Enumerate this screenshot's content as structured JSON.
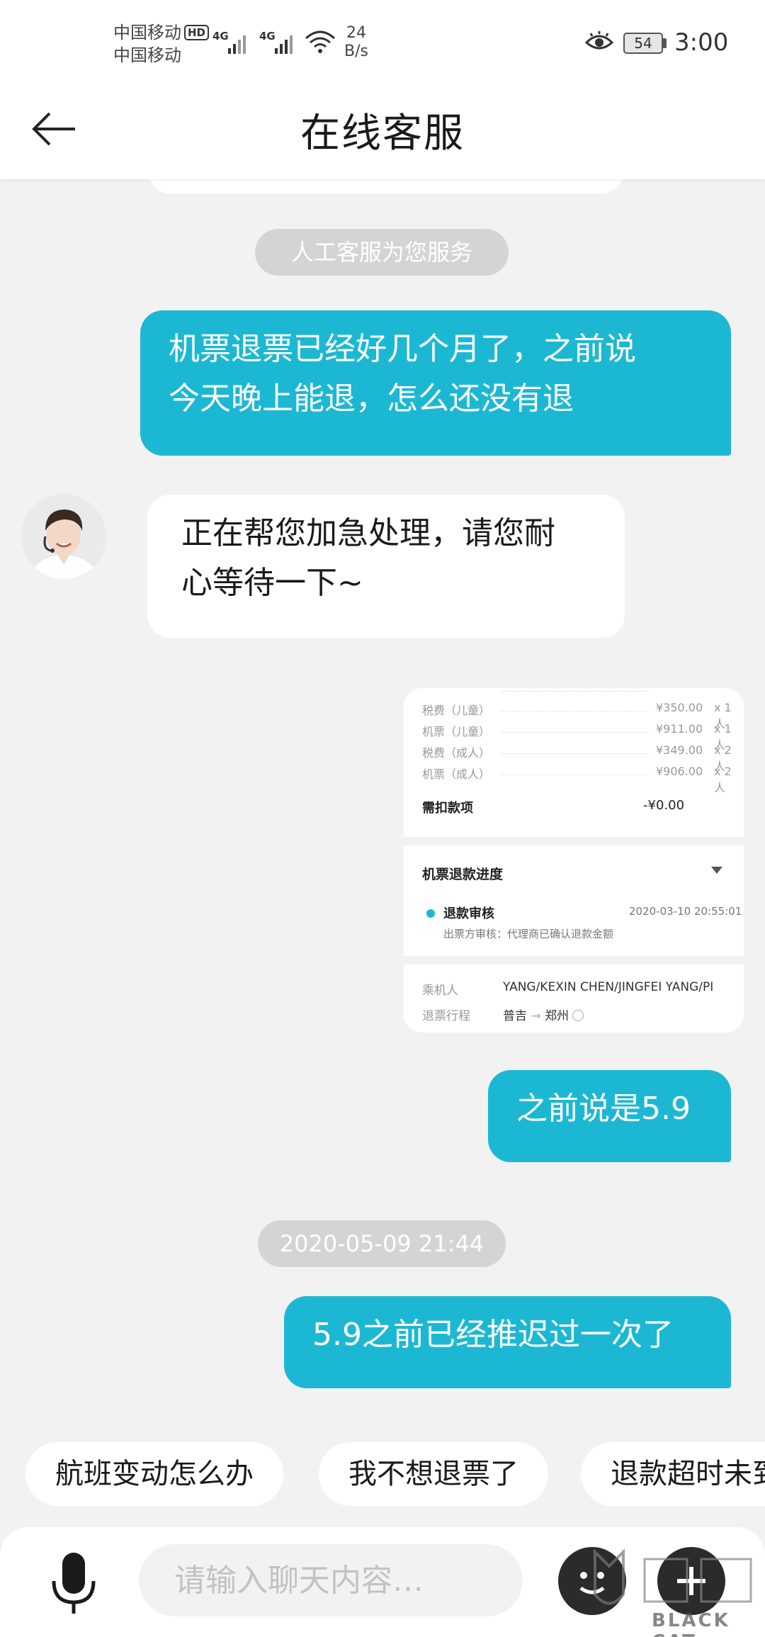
{
  "status_bar": {
    "carrier1": "中国移动",
    "carrier2": "中国移动",
    "hd": "HD",
    "net1": "4G",
    "net2": "4G",
    "speed_value": "24",
    "speed_unit": "B/s",
    "battery": "54",
    "time": "3:00"
  },
  "header": {
    "title": "在线客服"
  },
  "messages": {
    "system_notice": "人工客服为您服务",
    "user_msg_1_line1": "机票退票已经好几个月了，之前说",
    "user_msg_1_line2": "今天晚上能退，怎么还没有退",
    "agent_msg_1_line1": "正在帮您加急处理，请您耐",
    "agent_msg_1_line2": "心等待一下~",
    "user_msg_2": "之前说是5.9",
    "timestamp": "2020-05-09 21:44",
    "user_msg_3": "5.9之前已经推迟过一次了"
  },
  "screenshot_card": {
    "fee_rows": [
      {
        "name": "税费（儿童）",
        "price": "¥350.00",
        "qty": "x 1人"
      },
      {
        "name": "机票（儿童）",
        "price": "¥911.00",
        "qty": "x 1人"
      },
      {
        "name": "税费（成人）",
        "price": "¥349.00",
        "qty": "x 2人"
      },
      {
        "name": "机票（成人）",
        "price": "¥906.00",
        "qty": "x 2人"
      }
    ],
    "deduct_label": "需扣款项",
    "deduct_value": "-¥0.00",
    "progress_title": "机票退款进度",
    "progress_step": "退款审核",
    "progress_time": "2020-03-10 20:55:01",
    "progress_desc": "出票方审核：代理商已确认退款金额",
    "passenger_label": "乘机人",
    "passenger_value": "YANG/KEXIN CHEN/JINGFEI YANG/PI",
    "route_label": "退票行程",
    "route_from": "普吉",
    "route_arrow": "→",
    "route_to": "郑州"
  },
  "quick_replies": [
    "航班变动怎么办",
    "我不想退票了",
    "退款超时未到"
  ],
  "input": {
    "placeholder": "请输入聊天内容…"
  },
  "watermark": {
    "text": "BLACK CAT"
  },
  "colors": {
    "accent": "#1cb8d3",
    "background": "#f2f2f2",
    "pill": "#d4d4d4"
  }
}
